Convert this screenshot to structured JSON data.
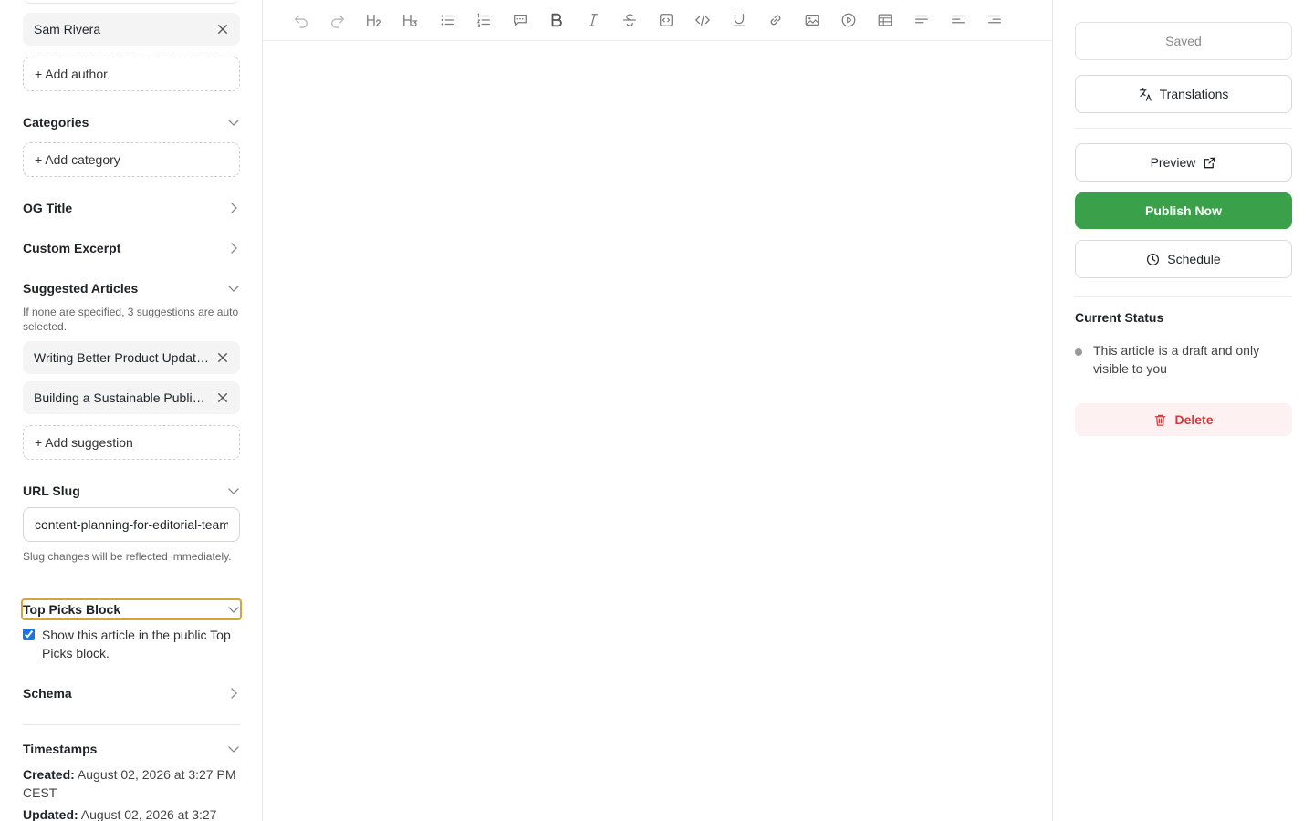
{
  "authors": {
    "chip": "Sam Rivera",
    "add_label": "+ Add author"
  },
  "categories": {
    "title": "Categories",
    "add_label": "+ Add category"
  },
  "og_title": {
    "title": "OG Title"
  },
  "custom_excerpt": {
    "title": "Custom Excerpt"
  },
  "suggested": {
    "title": "Suggested Articles",
    "help": "If none are specified, 3 suggestions are auto selected.",
    "items": [
      "Writing Better Product Updates",
      "Building a Sustainable Publishing Workflow"
    ],
    "add_label": "+ Add suggestion"
  },
  "slug": {
    "title": "URL Slug",
    "value": "content-planning-for-editorial-teams",
    "help": "Slug changes will be reflected immediately."
  },
  "top_picks": {
    "title": "Top Picks Block",
    "checkbox_label": "Show this article in the public Top Picks block.",
    "checked": true
  },
  "schema": {
    "title": "Schema"
  },
  "timestamps": {
    "title": "Timestamps",
    "created_label": "Created:",
    "created_value": "August 02, 2026 at 3:27 PM CEST",
    "updated_label": "Updated:",
    "updated_value": "August 02, 2026 at 3:27"
  },
  "toolbar": {
    "icons": [
      "undo-icon",
      "redo-icon",
      "heading-2-icon",
      "heading-3-icon",
      "bullet-list-icon",
      "ordered-list-icon",
      "comment-icon",
      "bold-icon",
      "italic-icon",
      "strikethrough-icon",
      "code-block-icon",
      "code-icon",
      "underline-icon",
      "link-icon",
      "image-icon",
      "video-icon",
      "table-icon",
      "align-justify-icon",
      "align-left-icon",
      "align-right-icon"
    ]
  },
  "right": {
    "saved_label": "Saved",
    "translations_label": "Translations",
    "preview_label": "Preview",
    "publish_label": "Publish Now",
    "schedule_label": "Schedule",
    "status_title": "Current Status",
    "status_text": "This article is a draft and only visible to you",
    "delete_label": "Delete"
  },
  "colors": {
    "publish": "#3aa14a",
    "delete_text": "#d13a3a",
    "delete_bg": "#fdf1f1",
    "focus_outline": "#d4a53c",
    "checkbox": "#1a73e8"
  }
}
